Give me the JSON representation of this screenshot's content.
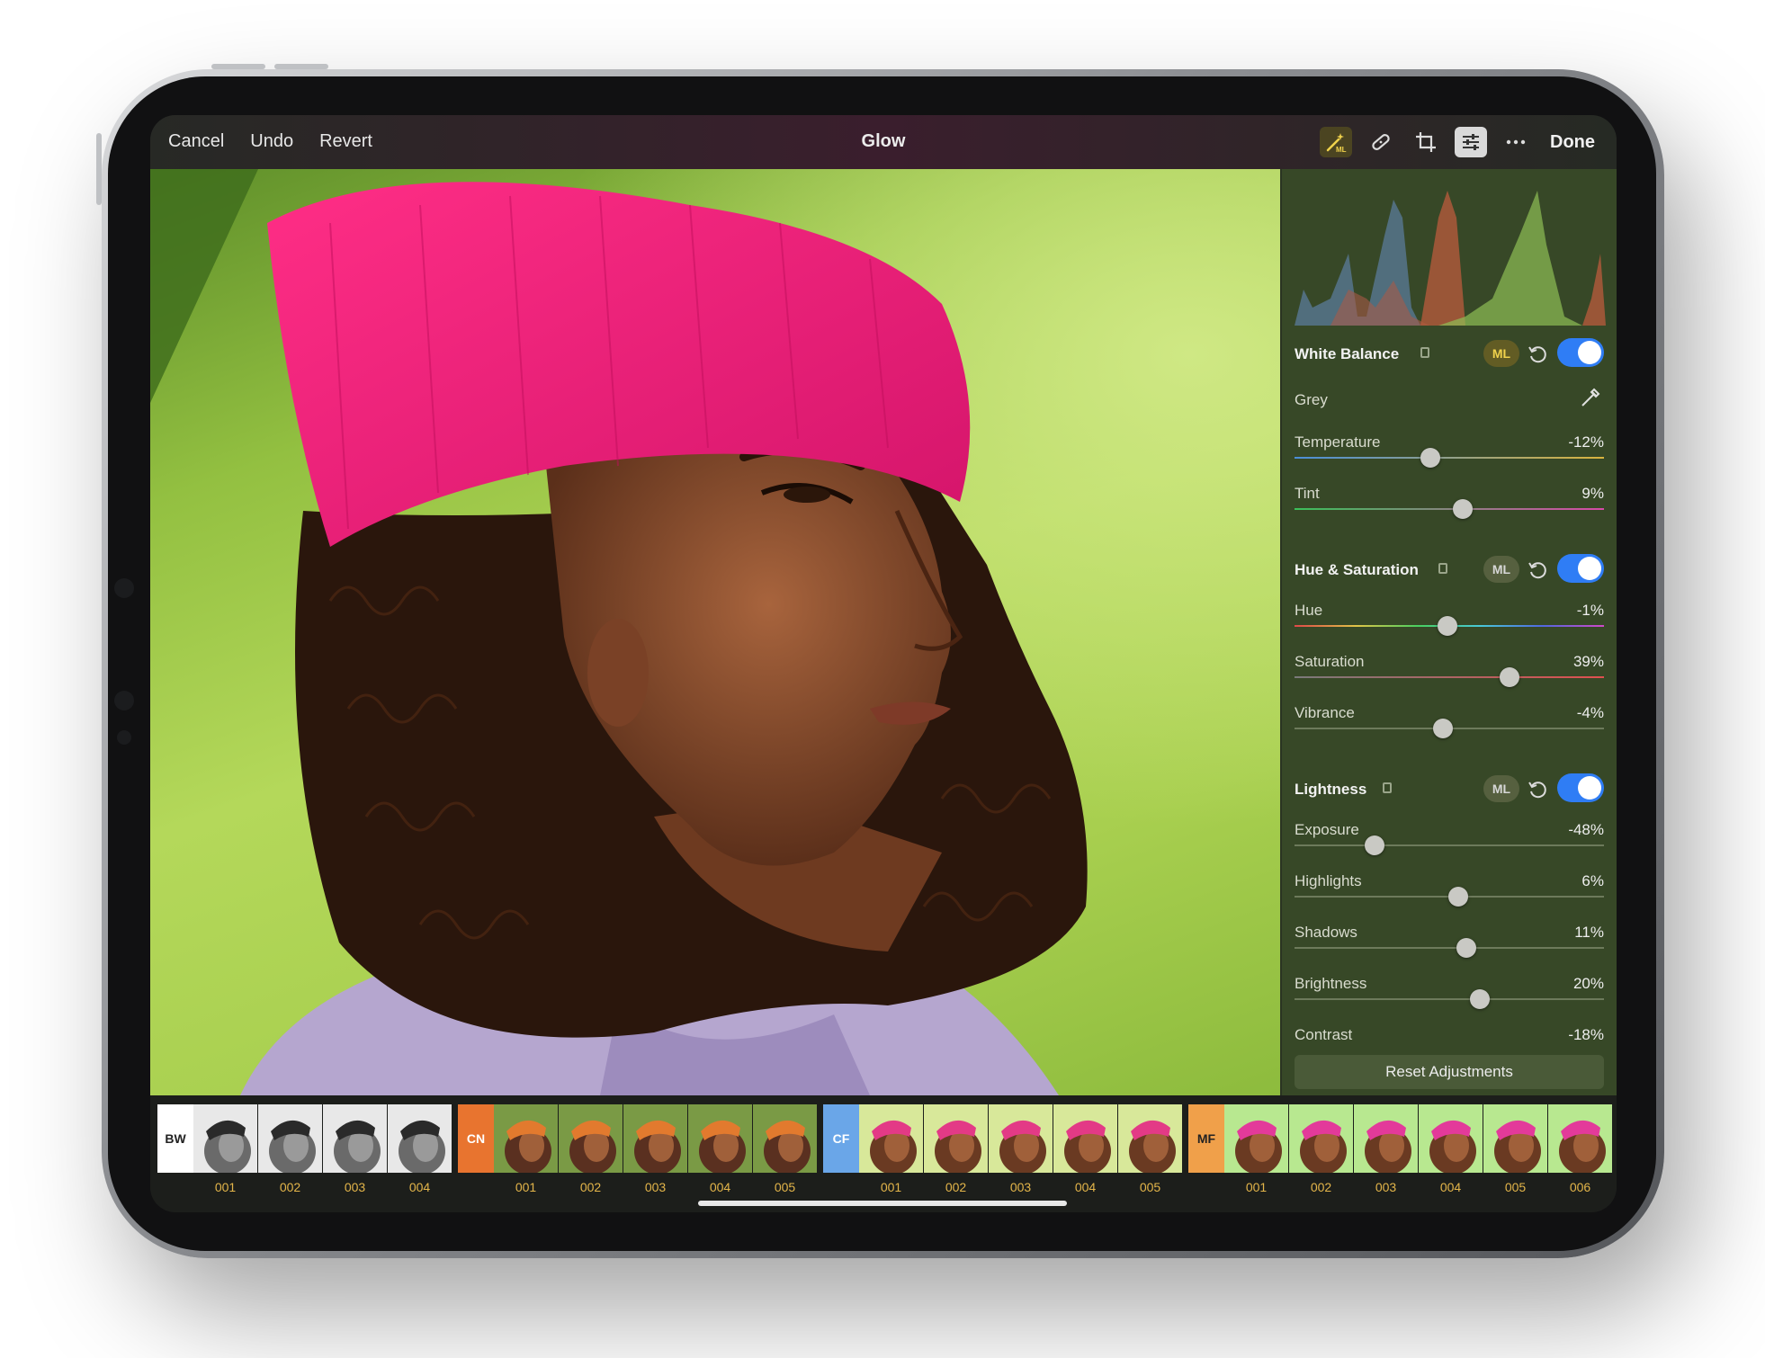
{
  "topbar": {
    "cancel": "Cancel",
    "undo": "Undo",
    "revert": "Revert",
    "title": "Glow",
    "done": "Done",
    "icons": [
      "ml-enhance-icon",
      "bandage-icon",
      "crop-icon",
      "adjustments-icon",
      "more-icon"
    ]
  },
  "panel": {
    "white_balance": {
      "title": "White Balance",
      "ml": "ML",
      "grey_label": "Grey",
      "rows": [
        {
          "label": "Temperature",
          "value": "-12%",
          "pos": -0.12
        },
        {
          "label": "Tint",
          "value": "9%",
          "pos": 0.09
        }
      ]
    },
    "hue_saturation": {
      "title": "Hue & Saturation",
      "ml": "ML",
      "rows": [
        {
          "label": "Hue",
          "value": "-1%",
          "pos": -0.01
        },
        {
          "label": "Saturation",
          "value": "39%",
          "pos": 0.39
        },
        {
          "label": "Vibrance",
          "value": "-4%",
          "pos": -0.04
        }
      ]
    },
    "lightness": {
      "title": "Lightness",
      "ml": "ML",
      "rows": [
        {
          "label": "Exposure",
          "value": "-48%",
          "pos": -0.48
        },
        {
          "label": "Highlights",
          "value": "6%",
          "pos": 0.06
        },
        {
          "label": "Shadows",
          "value": "11%",
          "pos": 0.11
        },
        {
          "label": "Brightness",
          "value": "20%",
          "pos": 0.2
        },
        {
          "label": "Contrast",
          "value": "-18%",
          "pos": -0.18
        }
      ]
    },
    "reset": "Reset Adjustments"
  },
  "filmstrip": [
    {
      "tag": "BW",
      "color": "#ffffff",
      "thumbs": [
        "001",
        "002",
        "003",
        "004"
      ],
      "tone": "bw"
    },
    {
      "tag": "CN",
      "color": "#e8742f",
      "thumbs": [
        "001",
        "002",
        "003",
        "004",
        "005"
      ],
      "tone": "cn"
    },
    {
      "tag": "CF",
      "color": "#6aa6e8",
      "thumbs": [
        "001",
        "002",
        "003",
        "004",
        "005"
      ],
      "tone": "cf"
    },
    {
      "tag": "MF",
      "color": "#f0a04a",
      "thumbs": [
        "001",
        "002",
        "003",
        "004",
        "005",
        "006"
      ],
      "tone": "mf"
    }
  ],
  "colors": {
    "accent_toggle": "#2f7df5",
    "ml_active": "#f0d24c",
    "thumb_number": "#e3b54a"
  }
}
